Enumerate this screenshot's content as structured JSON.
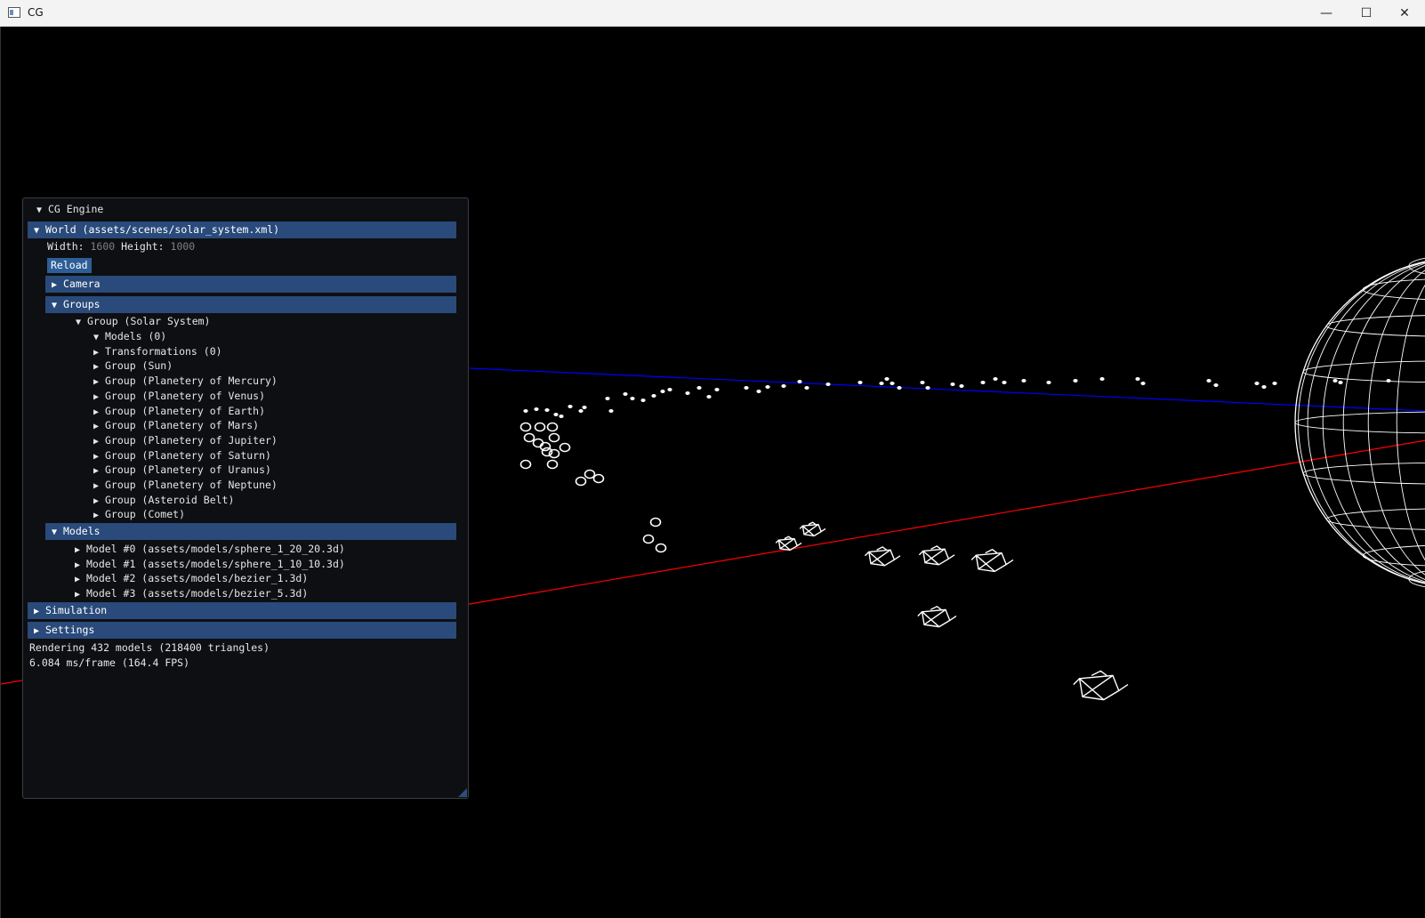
{
  "window": {
    "title": "CG",
    "minimize": "—",
    "maximize": "☐",
    "close": "✕"
  },
  "panel": {
    "title": "CG Engine",
    "world": {
      "label": "World (assets/scenes/solar_system.xml)",
      "width_label": "Width:",
      "width_value": "1600",
      "height_label": "Height:",
      "height_value": "1000",
      "reload": "Reload"
    },
    "camera": "Camera",
    "groups": {
      "label": "Groups",
      "root": "Group (Solar System)",
      "items": [
        "Models (0)",
        "Transformations (0)",
        "Group (Sun)",
        "Group (Planetery of Mercury)",
        "Group (Planetery of Venus)",
        "Group (Planetery of Earth)",
        "Group (Planetery of Mars)",
        "Group (Planetery of Jupiter)",
        "Group (Planetery of Saturn)",
        "Group (Planetery of Uranus)",
        "Group (Planetery of Neptune)",
        "Group (Asteroid Belt)",
        "Group (Comet)"
      ]
    },
    "models": {
      "label": "Models",
      "items": [
        "Model #0 (assets/models/sphere_1_20_20.3d)",
        "Model #1 (assets/models/sphere_1_10_10.3d)",
        "Model #2 (assets/models/bezier_1.3d)",
        "Model #3 (assets/models/bezier_5.3d)"
      ]
    },
    "simulation": "Simulation",
    "settings": "Settings",
    "stats_render": "Rendering 432 models (218400 triangles)",
    "stats_frame": "6.084 ms/frame (164.4 FPS)"
  },
  "colors": {
    "x_axis": "#ff0000",
    "z_axis": "#0000ff",
    "wire": "#ffffff",
    "header": "#294a7a"
  }
}
